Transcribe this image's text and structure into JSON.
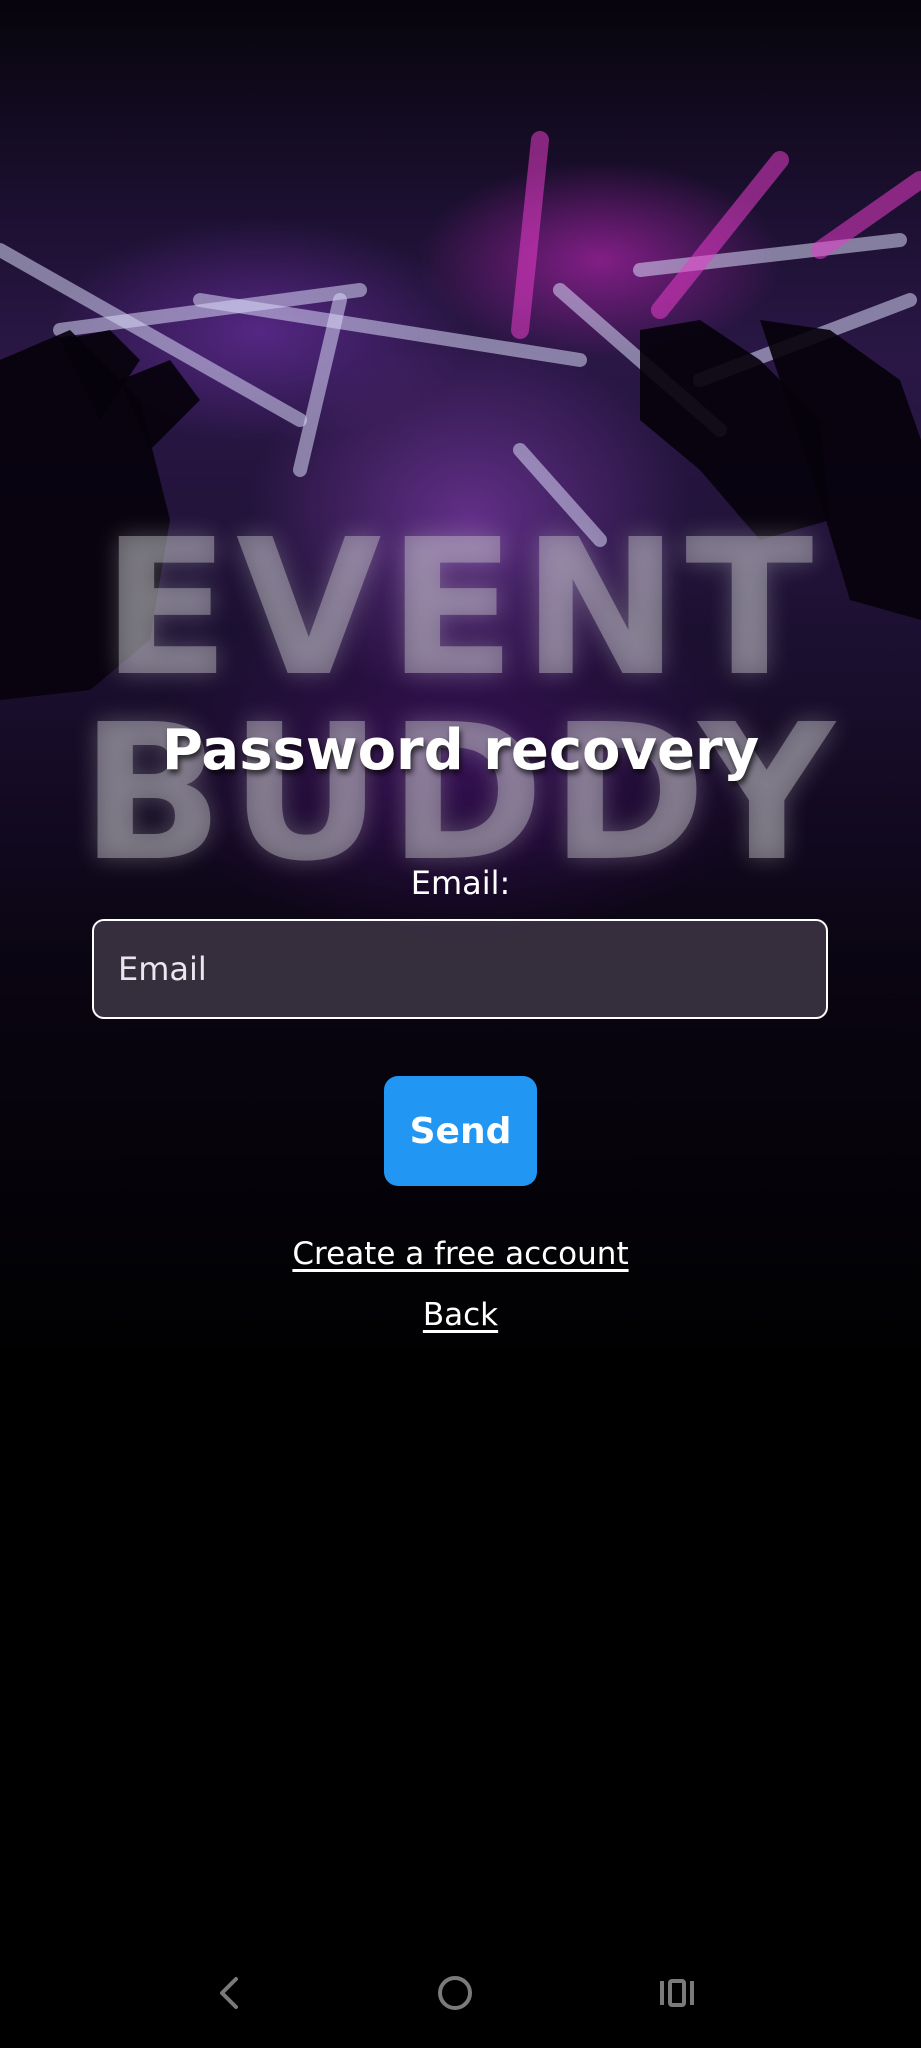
{
  "watermark": {
    "line1": "EVENT",
    "line2": "BUDDY"
  },
  "page": {
    "title": "Password recovery"
  },
  "form": {
    "email_label": "Email:",
    "email_placeholder": "Email",
    "email_value": "",
    "send_label": "Send"
  },
  "links": {
    "create_account": "Create a free account",
    "back": "Back"
  },
  "colors": {
    "accent_button": "#2196f3",
    "background": "#000000",
    "text": "#ffffff"
  },
  "navbar": {
    "icons": [
      "back-icon",
      "home-icon",
      "recent-apps-icon"
    ]
  }
}
